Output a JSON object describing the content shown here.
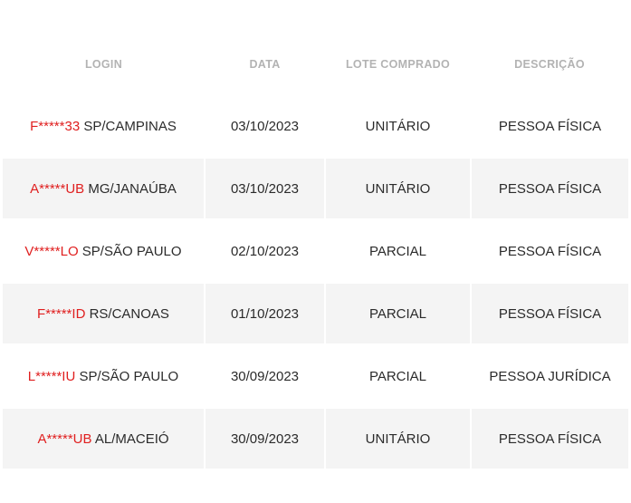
{
  "colors": {
    "header_text": "#b3b3b3",
    "body_text": "#2b2b2b",
    "masked_login": "#e02020",
    "stripe": "#f4f4f4"
  },
  "table": {
    "headers": [
      "LOGIN",
      "DATA",
      "LOTE COMPRADO",
      "DESCRIÇÃO"
    ],
    "rows": [
      {
        "login_masked": "F*****33",
        "location": "SP/CAMPINAS",
        "date": "03/10/2023",
        "lot": "UNITÁRIO",
        "description": "PESSOA FÍSICA"
      },
      {
        "login_masked": "A*****UB",
        "location": "MG/JANAÚBA",
        "date": "03/10/2023",
        "lot": "UNITÁRIO",
        "description": "PESSOA FÍSICA"
      },
      {
        "login_masked": "V*****LO",
        "location": "SP/SÃO PAULO",
        "date": "02/10/2023",
        "lot": "PARCIAL",
        "description": "PESSOA FÍSICA"
      },
      {
        "login_masked": "F*****ID",
        "location": "RS/CANOAS",
        "date": "01/10/2023",
        "lot": "PARCIAL",
        "description": "PESSOA FÍSICA"
      },
      {
        "login_masked": "L*****IU",
        "location": "SP/SÃO PAULO",
        "date": "30/09/2023",
        "lot": "PARCIAL",
        "description": "PESSOA JURÍDICA"
      },
      {
        "login_masked": "A*****UB",
        "location": "AL/MACEIÓ",
        "date": "30/09/2023",
        "lot": "UNITÁRIO",
        "description": "PESSOA FÍSICA"
      }
    ]
  }
}
